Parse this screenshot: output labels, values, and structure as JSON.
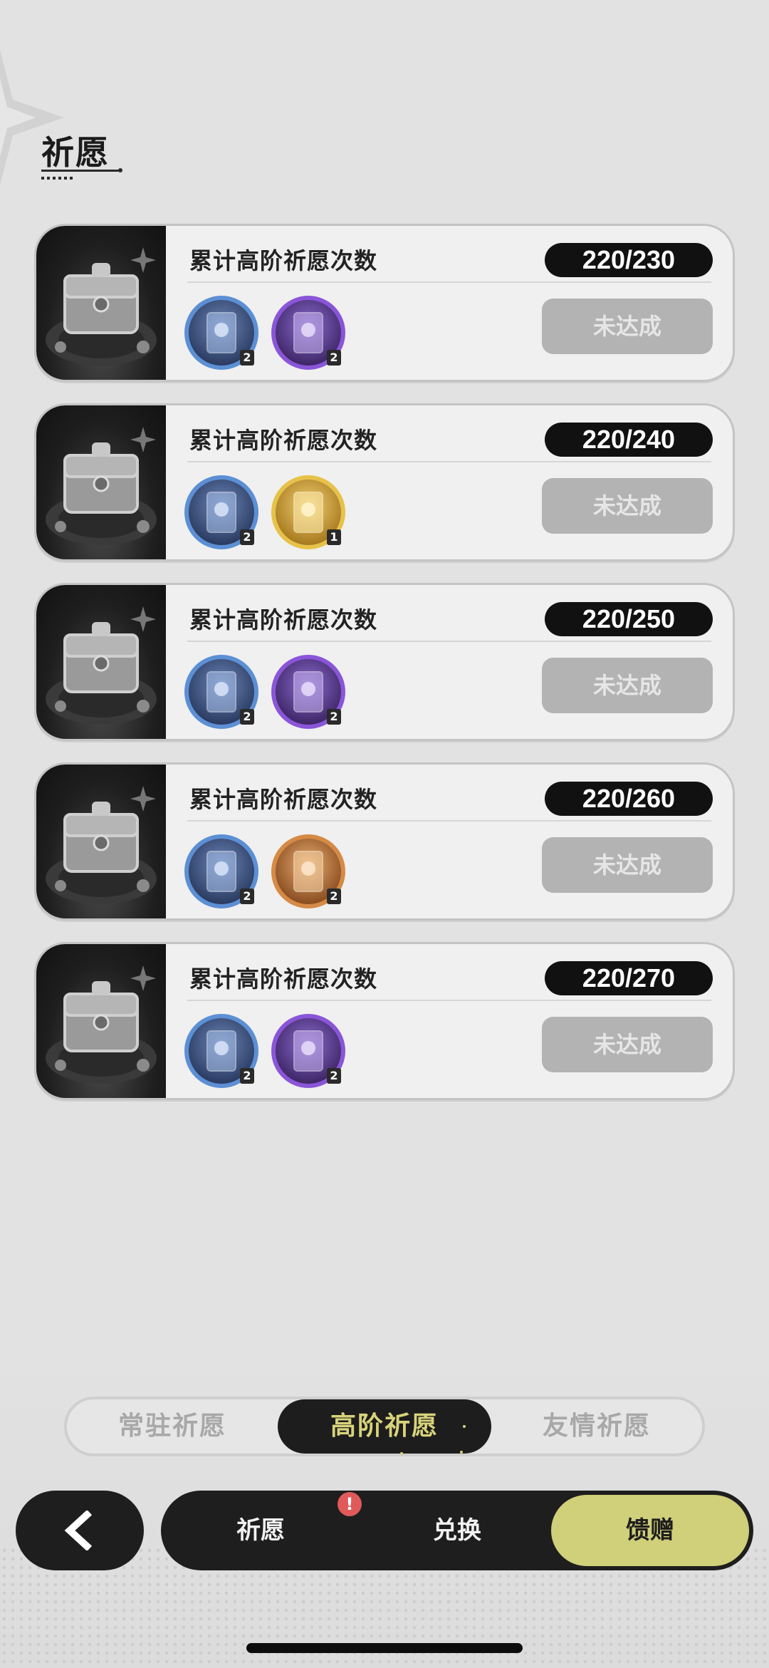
{
  "page": {
    "title": "祈愿"
  },
  "milestones": [
    {
      "title": "累计高阶祈愿次数",
      "progress": "220/230",
      "status": "未达成",
      "rewards": [
        {
          "color": "blue",
          "icon": "character-card-icon",
          "count": "2"
        },
        {
          "color": "purple",
          "icon": "character-card-icon",
          "count": "2"
        }
      ]
    },
    {
      "title": "累计高阶祈愿次数",
      "progress": "220/240",
      "status": "未达成",
      "rewards": [
        {
          "color": "blue",
          "icon": "character-card-icon",
          "count": "2"
        },
        {
          "color": "gold",
          "icon": "character-card-icon",
          "count": "1"
        }
      ]
    },
    {
      "title": "累计高阶祈愿次数",
      "progress": "220/250",
      "status": "未达成",
      "rewards": [
        {
          "color": "blue",
          "icon": "character-card-icon",
          "count": "2"
        },
        {
          "color": "purple",
          "icon": "character-card-icon",
          "count": "2"
        }
      ]
    },
    {
      "title": "累计高阶祈愿次数",
      "progress": "220/260",
      "status": "未达成",
      "rewards": [
        {
          "color": "blue",
          "icon": "character-card-icon",
          "count": "2"
        },
        {
          "color": "orange",
          "icon": "character-card-icon",
          "count": "2"
        }
      ]
    },
    {
      "title": "累计高阶祈愿次数",
      "progress": "220/270",
      "status": "未达成",
      "rewards": [
        {
          "color": "blue",
          "icon": "character-card-icon",
          "count": "2"
        },
        {
          "color": "purple",
          "icon": "character-card-icon",
          "count": "2"
        }
      ]
    }
  ],
  "tabs": [
    {
      "label": "常驻祈愿",
      "active": false
    },
    {
      "label": "高阶祈愿",
      "active": true
    },
    {
      "label": "友情祈愿",
      "active": false
    }
  ],
  "nav": {
    "back_icon": "chevron-left-icon",
    "items": [
      {
        "label": "祈愿",
        "active": false
      },
      {
        "label": "兑换",
        "active": false
      },
      {
        "label": "馈赠",
        "active": true
      }
    ],
    "alert_badge": "!"
  },
  "colors": {
    "accent": "#d0cf7a",
    "dark": "#1e1e1e",
    "background": "#e2e2e2",
    "reward_blue": "#5c8fd4",
    "reward_purple": "#8a55d8",
    "reward_gold": "#e6c24a",
    "reward_orange": "#d58a46"
  }
}
